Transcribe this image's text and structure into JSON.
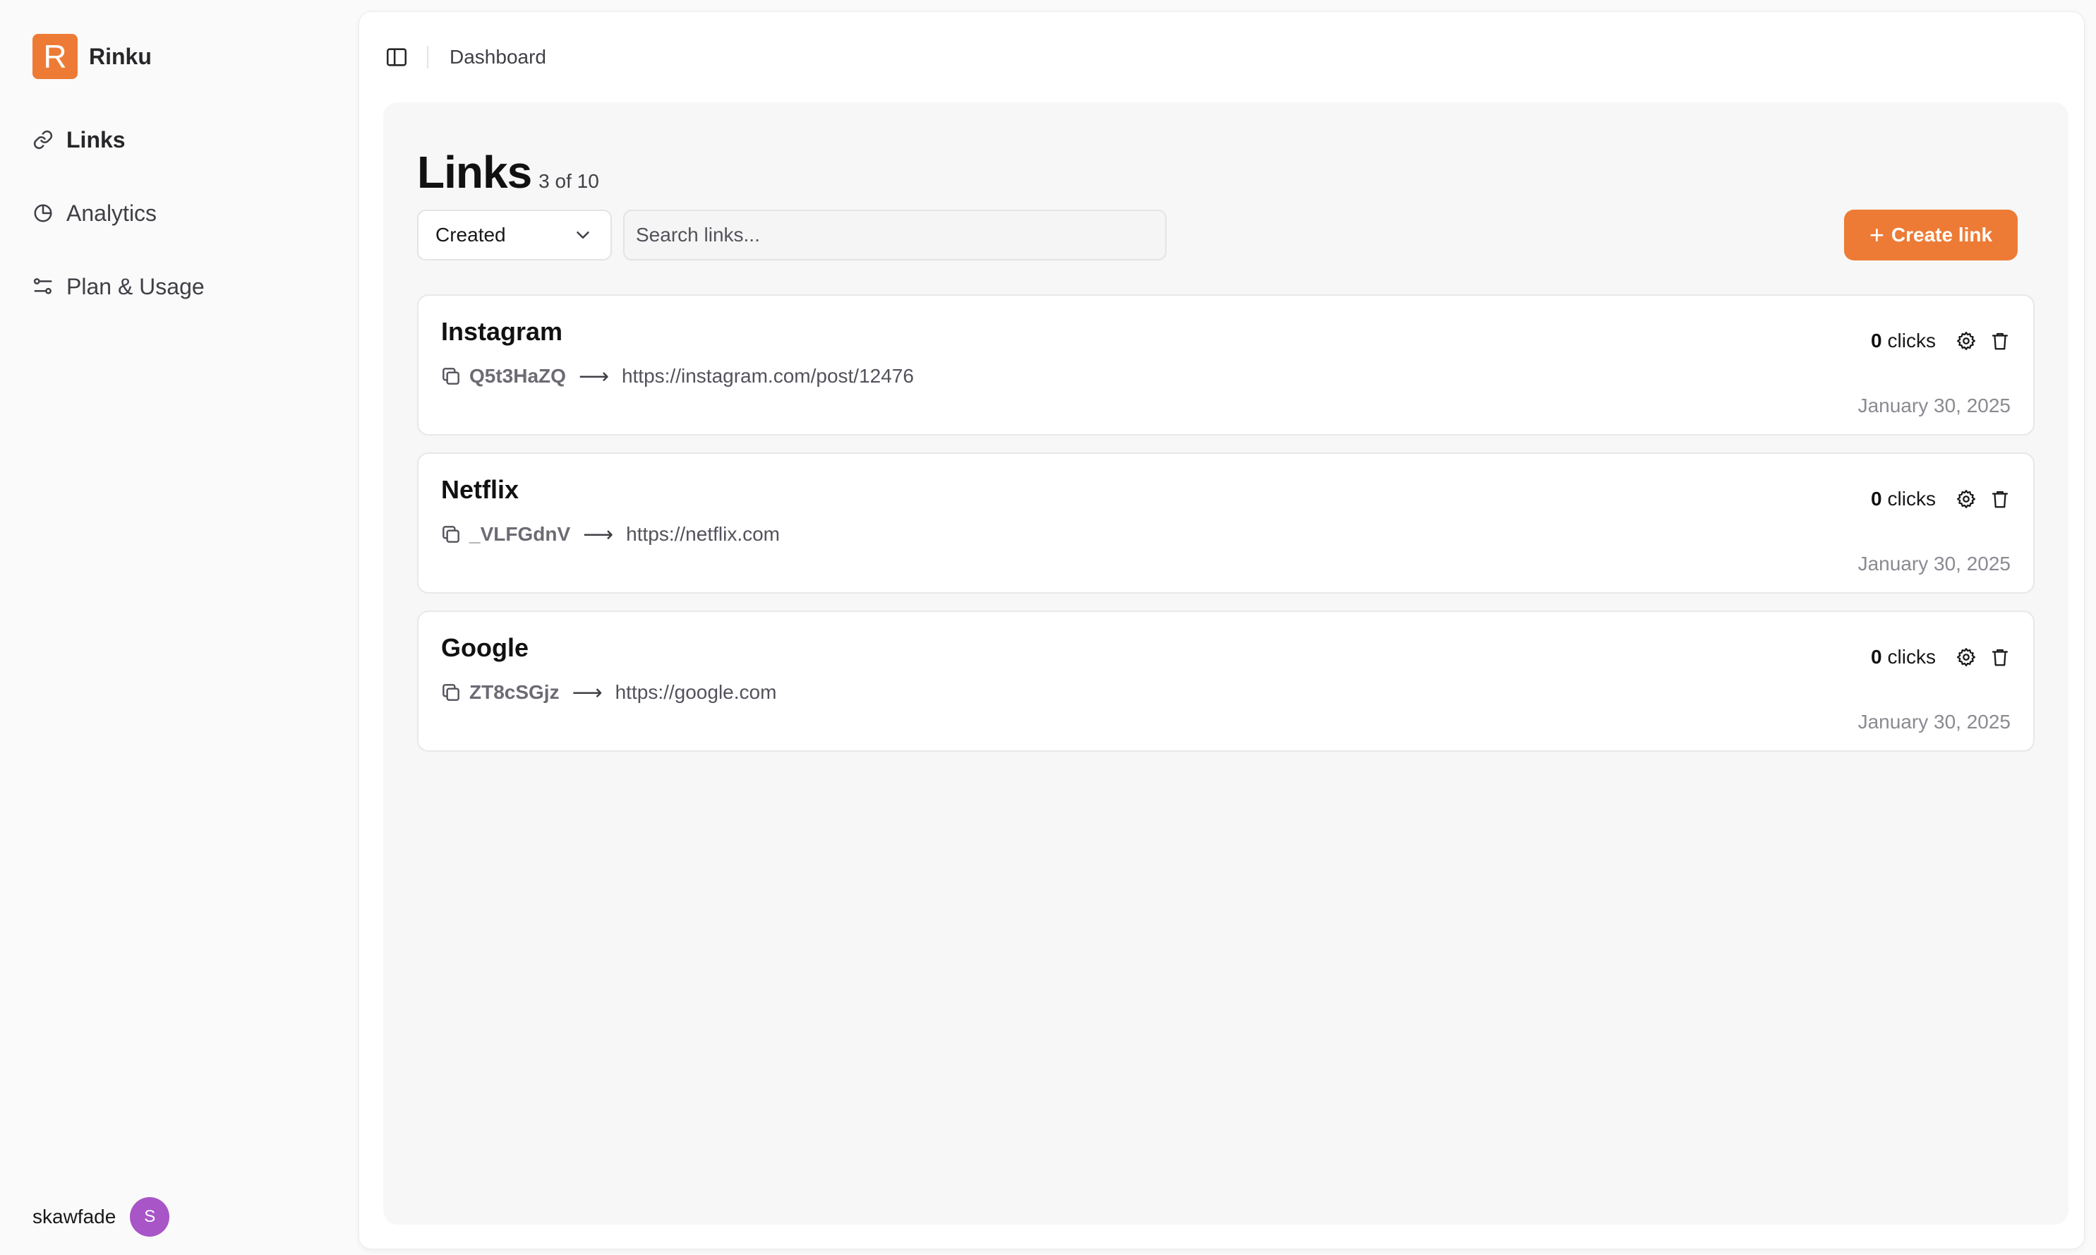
{
  "brand": {
    "logo_letter": "R",
    "name": "Rinku",
    "accent": "#ed7b35"
  },
  "sidebar": {
    "items": [
      {
        "label": "Links",
        "icon": "link-icon",
        "active": true
      },
      {
        "label": "Analytics",
        "icon": "pie-chart-icon",
        "active": false
      },
      {
        "label": "Plan & Usage",
        "icon": "sliders-icon",
        "active": false
      }
    ]
  },
  "user": {
    "name": "skawfade",
    "initial": "S",
    "avatar_color": "#a855c8"
  },
  "header": {
    "breadcrumb": "Dashboard"
  },
  "page": {
    "title": "Links",
    "count": "3 of 10",
    "sort_value": "Created",
    "search_placeholder": "Search links...",
    "create_label": "Create link"
  },
  "links": [
    {
      "title": "Instagram",
      "slug": "Q5t3HaZQ",
      "url": "https://instagram.com/post/12476",
      "clicks": "0",
      "clicks_label": "clicks",
      "date": "January 30, 2025"
    },
    {
      "title": "Netflix",
      "slug": "_VLFGdnV",
      "url": "https://netflix.com",
      "clicks": "0",
      "clicks_label": "clicks",
      "date": "January 30, 2025"
    },
    {
      "title": "Google",
      "slug": "ZT8cSGjz",
      "url": "https://google.com",
      "clicks": "0",
      "clicks_label": "clicks",
      "date": "January 30, 2025"
    }
  ]
}
